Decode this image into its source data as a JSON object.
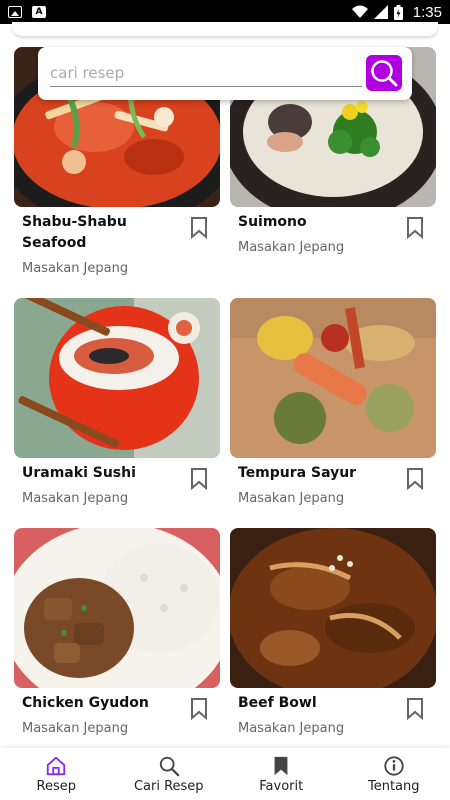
{
  "status_bar": {
    "time": "1:35",
    "left_icons": [
      "image-icon",
      "a-badge-icon"
    ],
    "right_icons": [
      "wifi-icon",
      "signal-icon",
      "battery-icon"
    ]
  },
  "search": {
    "placeholder": "cari resep",
    "value": "",
    "button_icon": "search-icon",
    "button_color": "#b000e0"
  },
  "recipes": [
    {
      "title": "Shabu-Shabu Seafood",
      "category": "Masakan Jepang",
      "image": "shabu-shabu-photo"
    },
    {
      "title": "Suimono",
      "category": "Masakan Jepang",
      "image": "suimono-photo"
    },
    {
      "title": "Uramaki Sushi",
      "category": "Masakan Jepang",
      "image": "uramaki-sushi-photo"
    },
    {
      "title": "Tempura Sayur",
      "category": "Masakan Jepang",
      "image": "tempura-sayur-photo"
    },
    {
      "title": "Chicken Gyudon",
      "category": "Masakan Jepang",
      "image": "chicken-gyudon-photo"
    },
    {
      "title": "Beef Bowl",
      "category": "Masakan Jepang",
      "image": "beef-bowl-photo"
    }
  ],
  "bottom_nav": [
    {
      "label": "Resep",
      "icon": "home-icon",
      "active": true
    },
    {
      "label": "Cari Resep",
      "icon": "search-icon",
      "active": false
    },
    {
      "label": "Favorit",
      "icon": "bookmark-icon",
      "active": false
    },
    {
      "label": "Tentang",
      "icon": "info-icon",
      "active": false
    }
  ],
  "colors": {
    "accent": "#b000e0",
    "nav_active": "#8a2be2"
  }
}
